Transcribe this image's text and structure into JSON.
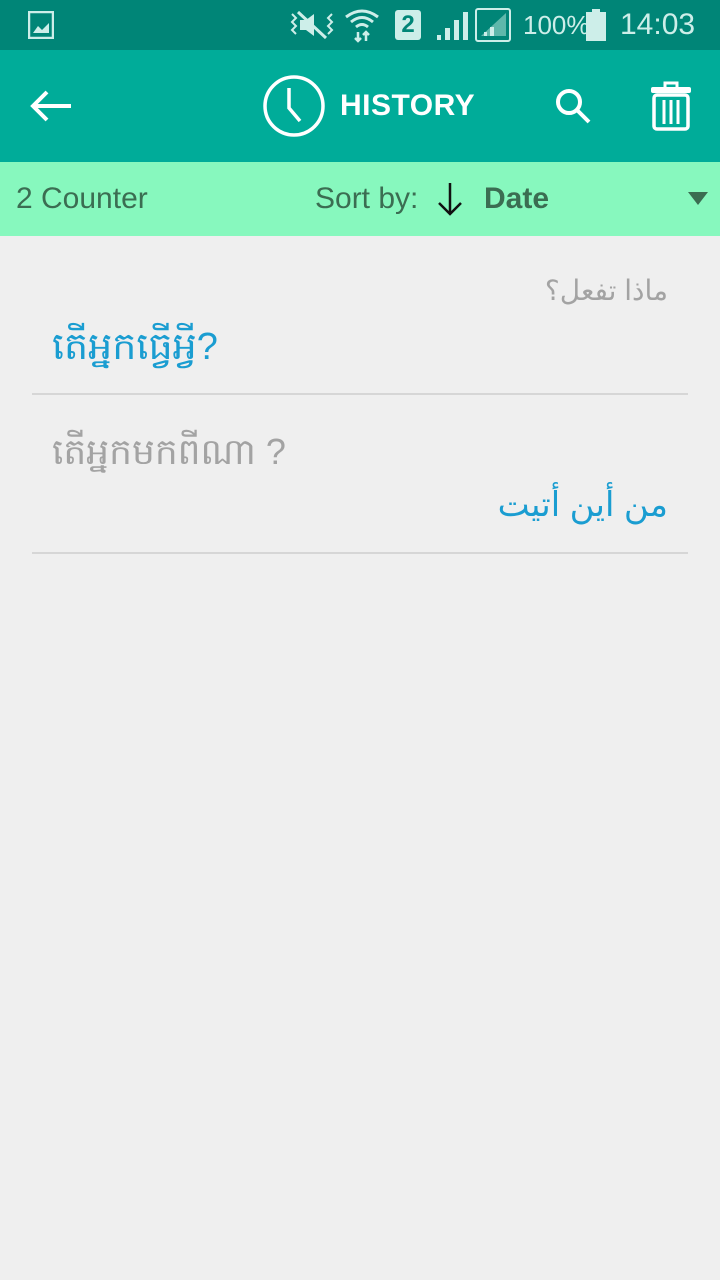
{
  "status_bar": {
    "icons": [
      "gallery-icon",
      "vibrate-mute-icon",
      "wifi-data-icon",
      "sim2-icon",
      "signal-icon",
      "signal-box-icon",
      "battery-icon"
    ],
    "sim_label": "2",
    "battery_percent": "100%",
    "time": "14:03"
  },
  "app_bar": {
    "back_icon": "arrow-left-icon",
    "title_icon": "clock-icon",
    "title": "HISTORY",
    "search_icon": "search-icon",
    "delete_icon": "trash-icon"
  },
  "sort_bar": {
    "counter": "2 Counter",
    "sort_label": "Sort by:",
    "sort_direction_icon": "arrow-down-icon",
    "sort_value": "Date",
    "dropdown_icon": "triangle-down-icon"
  },
  "history": [
    {
      "source": "ماذا تفعل؟",
      "translation": "តើអ្នកធ្វើអ្វី?"
    },
    {
      "source": "តើអ្នកមកពីណា ?",
      "translation": "من أين أتيت"
    }
  ],
  "colors": {
    "status_bar": "#008577",
    "app_bar": "#00ac99",
    "sort_bar": "#87f8be",
    "accent_text": "#1a9dd1",
    "muted_text": "#a3a3a3"
  }
}
